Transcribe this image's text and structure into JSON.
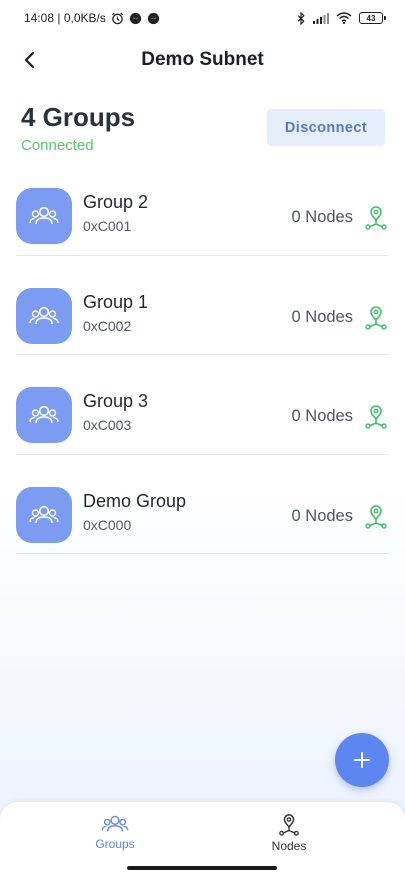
{
  "status_bar": {
    "time_speed": "14:08 | 0,0KB/s",
    "icons": [
      "alarm-icon",
      "messenger-icon",
      "messenger-icon",
      "bluetooth-icon",
      "signal-icon",
      "wifi-icon",
      "battery-icon"
    ],
    "battery": "43"
  },
  "header": {
    "title": "Demo Subnet",
    "back_icon": "back-arrow-icon"
  },
  "summary": {
    "groups_count": "4 Groups",
    "status": "Connected",
    "disconnect_label": "Disconnect"
  },
  "groups": [
    {
      "name": "Group 2",
      "address": "0xC001",
      "nodes": "0 Nodes"
    },
    {
      "name": "Group 1",
      "address": "0xC002",
      "nodes": "0 Nodes"
    },
    {
      "name": "Group 3",
      "address": "0xC003",
      "nodes": "0 Nodes"
    },
    {
      "name": "Demo Group",
      "address": "0xC000",
      "nodes": "0 Nodes"
    }
  ],
  "fab": {
    "icon": "plus-icon"
  },
  "bottom_nav": {
    "groups_label": "Groups",
    "nodes_label": "Nodes"
  },
  "colors": {
    "accent": "#5e86f0",
    "avatar": "#7c9bf3",
    "connected": "#58c46a",
    "node_icon": "#3dbf6a",
    "disconnect_bg": "#e5eefb"
  }
}
